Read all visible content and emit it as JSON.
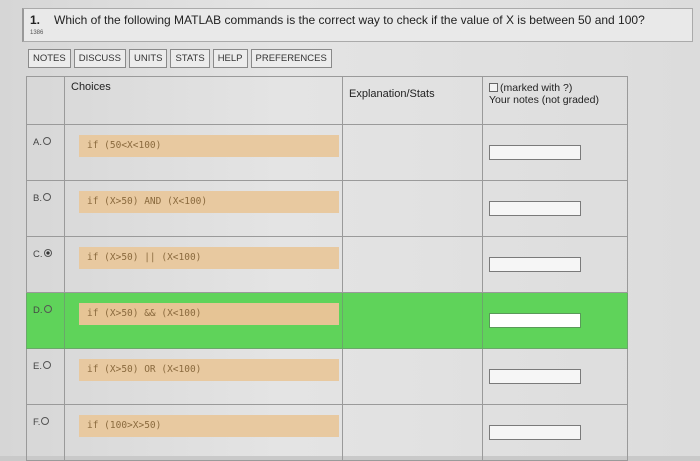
{
  "question": {
    "number": "1.",
    "text": "Which of the following MATLAB commands is the correct way to check if the value of X is between 50 and 100?",
    "id": "1386"
  },
  "tabs": [
    "NOTES",
    "DISCUSS",
    "UNITS",
    "STATS",
    "HELP",
    "PREFERENCES"
  ],
  "table": {
    "headers": {
      "choices": "Choices",
      "explanation": "Explanation/Stats",
      "notes_line1": "(marked with ?)",
      "notes_line2": "Your notes (not graded)"
    },
    "rows": [
      {
        "label": "A.",
        "code": "if (50<X<100)"
      },
      {
        "label": "B.",
        "code": "if (X>50) AND (X<100)"
      },
      {
        "label": "C.",
        "code": "if (X>50) || (X<100)"
      },
      {
        "label": "D.",
        "code": "if (X>50) && (X<100)"
      },
      {
        "label": "E.",
        "code": "if (X>50) OR (X<100)"
      },
      {
        "label": "F.",
        "code": "if (100>X>50)"
      }
    ],
    "selected_row": "C",
    "highlighted_row": "D",
    "highlight_color": "#5fd35a"
  }
}
